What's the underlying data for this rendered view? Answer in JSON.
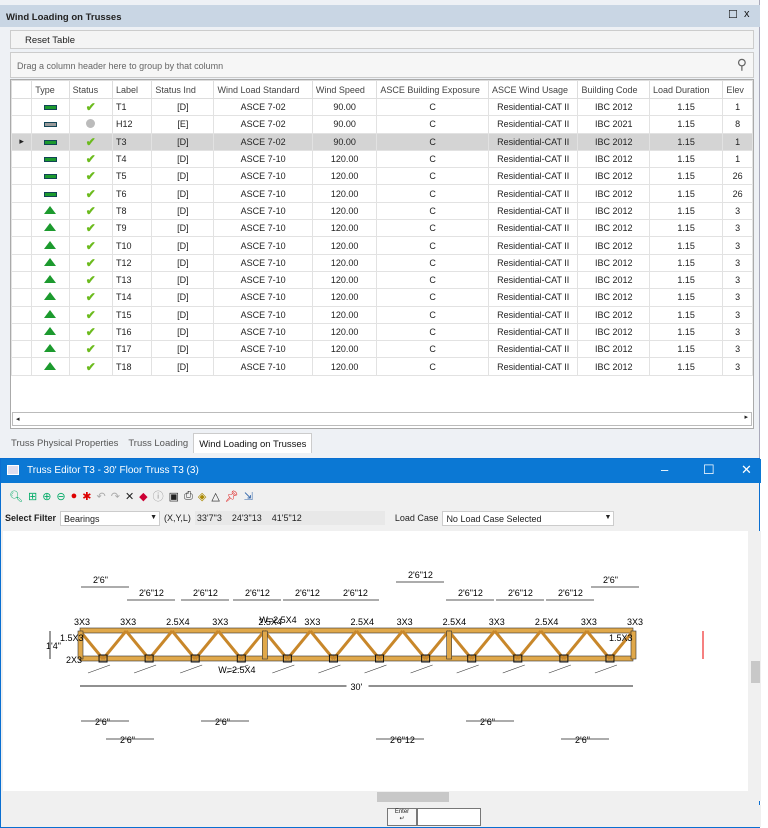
{
  "panel": {
    "title": "Wind Loading on Trusses",
    "reset": "Reset Table",
    "group_hint": "Drag a column header here to group by that column",
    "columns": [
      "Type",
      "Status",
      "Label",
      "Status Ind",
      "Wind Load Standard",
      "Wind Speed",
      "ASCE Building Exposure",
      "ASCE Wind Usage",
      "Building Code",
      "Load Duration",
      "Elev"
    ],
    "rows": [
      {
        "type": "floor",
        "status": "ok",
        "label": "T1",
        "ind": "[D]",
        "std": "ASCE 7-02",
        "speed": "90.00",
        "exp": "C",
        "usage": "Residential-CAT II",
        "code": "IBC 2012",
        "dur": "1.15",
        "elev": "1"
      },
      {
        "type": "floor-grey",
        "status": "none",
        "label": "H12",
        "ind": "[E]",
        "std": "ASCE 7-02",
        "speed": "90.00",
        "exp": "C",
        "usage": "Residential-CAT II",
        "code": "IBC 2021",
        "dur": "1.15",
        "elev": "8"
      },
      {
        "type": "floor",
        "status": "ok",
        "label": "T3",
        "ind": "[D]",
        "std": "ASCE 7-02",
        "speed": "90.00",
        "exp": "C",
        "usage": "Residential-CAT II",
        "code": "IBC 2012",
        "dur": "1.15",
        "elev": "1",
        "selected": true
      },
      {
        "type": "floor",
        "status": "ok",
        "label": "T4",
        "ind": "[D]",
        "std": "ASCE 7-10",
        "speed": "120.00",
        "exp": "C",
        "usage": "Residential-CAT II",
        "code": "IBC 2012",
        "dur": "1.15",
        "elev": "1"
      },
      {
        "type": "floor",
        "status": "ok",
        "label": "T5",
        "ind": "[D]",
        "std": "ASCE 7-10",
        "speed": "120.00",
        "exp": "C",
        "usage": "Residential-CAT II",
        "code": "IBC 2012",
        "dur": "1.15",
        "elev": "26"
      },
      {
        "type": "floor",
        "status": "ok",
        "label": "T6",
        "ind": "[D]",
        "std": "ASCE 7-10",
        "speed": "120.00",
        "exp": "C",
        "usage": "Residential-CAT II",
        "code": "IBC 2012",
        "dur": "1.15",
        "elev": "26"
      },
      {
        "type": "roof",
        "status": "ok",
        "label": "T8",
        "ind": "[D]",
        "std": "ASCE 7-10",
        "speed": "120.00",
        "exp": "C",
        "usage": "Residential-CAT II",
        "code": "IBC 2012",
        "dur": "1.15",
        "elev": "3"
      },
      {
        "type": "roof",
        "status": "ok",
        "label": "T9",
        "ind": "[D]",
        "std": "ASCE 7-10",
        "speed": "120.00",
        "exp": "C",
        "usage": "Residential-CAT II",
        "code": "IBC 2012",
        "dur": "1.15",
        "elev": "3"
      },
      {
        "type": "roof",
        "status": "ok",
        "label": "T10",
        "ind": "[D]",
        "std": "ASCE 7-10",
        "speed": "120.00",
        "exp": "C",
        "usage": "Residential-CAT II",
        "code": "IBC 2012",
        "dur": "1.15",
        "elev": "3"
      },
      {
        "type": "roof",
        "status": "ok",
        "label": "T12",
        "ind": "[D]",
        "std": "ASCE 7-10",
        "speed": "120.00",
        "exp": "C",
        "usage": "Residential-CAT II",
        "code": "IBC 2012",
        "dur": "1.15",
        "elev": "3"
      },
      {
        "type": "roof",
        "status": "ok",
        "label": "T13",
        "ind": "[D]",
        "std": "ASCE 7-10",
        "speed": "120.00",
        "exp": "C",
        "usage": "Residential-CAT II",
        "code": "IBC 2012",
        "dur": "1.15",
        "elev": "3"
      },
      {
        "type": "roof",
        "status": "ok",
        "label": "T14",
        "ind": "[D]",
        "std": "ASCE 7-10",
        "speed": "120.00",
        "exp": "C",
        "usage": "Residential-CAT II",
        "code": "IBC 2012",
        "dur": "1.15",
        "elev": "3"
      },
      {
        "type": "roof",
        "status": "ok",
        "label": "T15",
        "ind": "[D]",
        "std": "ASCE 7-10",
        "speed": "120.00",
        "exp": "C",
        "usage": "Residential-CAT II",
        "code": "IBC 2012",
        "dur": "1.15",
        "elev": "3"
      },
      {
        "type": "roof",
        "status": "ok",
        "label": "T16",
        "ind": "[D]",
        "std": "ASCE 7-10",
        "speed": "120.00",
        "exp": "C",
        "usage": "Residential-CAT II",
        "code": "IBC 2012",
        "dur": "1.15",
        "elev": "3"
      },
      {
        "type": "roof",
        "status": "ok",
        "label": "T17",
        "ind": "[D]",
        "std": "ASCE 7-10",
        "speed": "120.00",
        "exp": "C",
        "usage": "Residential-CAT II",
        "code": "IBC 2012",
        "dur": "1.15",
        "elev": "3"
      },
      {
        "type": "roof",
        "status": "ok",
        "label": "T18",
        "ind": "[D]",
        "std": "ASCE 7-10",
        "speed": "120.00",
        "exp": "C",
        "usage": "Residential-CAT II",
        "code": "IBC 2012",
        "dur": "1.15",
        "elev": "3"
      }
    ],
    "tabs": [
      "Truss Physical Properties",
      "Truss Loading",
      "Wind Loading on Trusses"
    ]
  },
  "editor": {
    "title": "Truss Editor  T3 - 30' Floor Truss T3 (3)",
    "filter_label": "Select Filter",
    "filter_value": "Bearings",
    "coord_label": "(X,Y,L)",
    "coords": "33'7\"3    24'3\"13    41'5\"12",
    "load_case_label": "Load Case",
    "load_case_value": "No Load Case Selected",
    "enter_label": "Enter"
  },
  "drawing": {
    "span": "30'",
    "top_dims": [
      "2'6\"",
      "2'6\"12",
      "2'6\"12",
      "2'6\"12",
      "2'6\"12",
      "2'6\"12",
      "2'6\"12",
      "2'6\"12",
      "2'6\"12",
      "2'6\"12",
      "2'6\""
    ],
    "height": "1'4\"",
    "plates_top": [
      "3X3",
      "3X3",
      "2.5X4",
      "3X3",
      "2.5X4",
      "3X3",
      "2.5X4",
      "3X3",
      "2.5X4",
      "3X3",
      "2.5X4",
      "3X3",
      "3X3"
    ],
    "plate_w": "W=2.5X4",
    "left_plates": [
      "1.5X3",
      "2X3"
    ],
    "right_plate": "1.5X3",
    "bottom_dims": [
      "2'6\"",
      "2'6\"",
      "2'6\"",
      "2'6\"12",
      "2'6\"",
      "2'6\""
    ]
  }
}
